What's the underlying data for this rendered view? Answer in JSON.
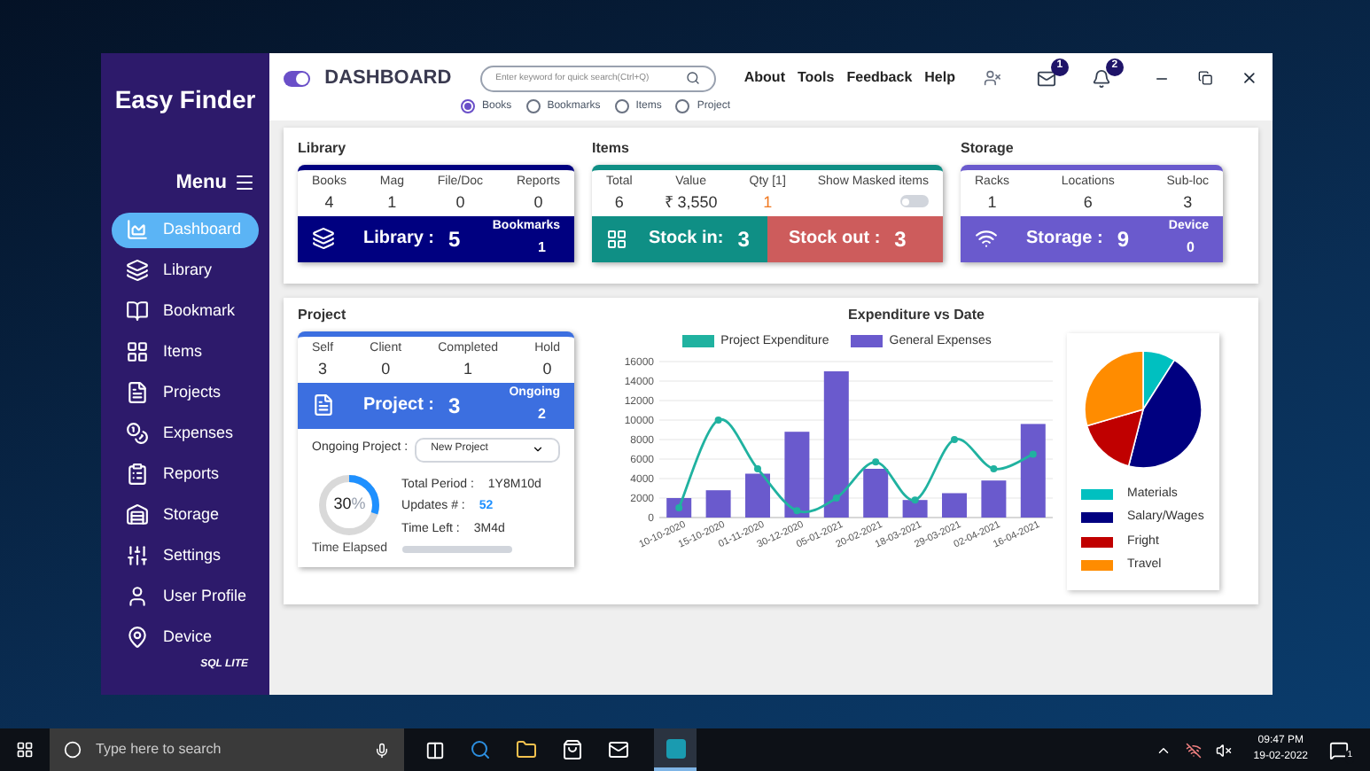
{
  "sidebar": {
    "logo": "Easy Finder",
    "menu_label": "Menu",
    "items": [
      {
        "label": "Dashboard",
        "selected": true
      },
      {
        "label": "Library",
        "selected": false
      },
      {
        "label": "Bookmark",
        "selected": false
      },
      {
        "label": "Items",
        "selected": false
      },
      {
        "label": "Projects",
        "selected": false
      },
      {
        "label": "Expenses",
        "selected": false
      },
      {
        "label": "Reports",
        "selected": false
      },
      {
        "label": "Storage",
        "selected": false
      },
      {
        "label": "Settings",
        "selected": false
      },
      {
        "label": "User Profile",
        "selected": false
      },
      {
        "label": "Device",
        "selected": false
      }
    ],
    "footer": "SQL LITE"
  },
  "header": {
    "toggle": {
      "on": true
    },
    "title": "DASHBOARD",
    "search": {
      "placeholder": "Enter keyword for quick search(Ctrl+Q)"
    },
    "search_scopes": [
      {
        "label": "Books",
        "selected": true
      },
      {
        "label": "Bookmarks",
        "selected": false
      },
      {
        "label": "Items",
        "selected": false
      },
      {
        "label": "Project",
        "selected": false
      }
    ],
    "menu": [
      "About",
      "Tools",
      "Feedback",
      "Help"
    ],
    "mail_badge": "1",
    "bell_badge": "2"
  },
  "library": {
    "title": "Library",
    "stats": [
      {
        "label": "Books",
        "value": "4"
      },
      {
        "label": "Mag",
        "value": "1"
      },
      {
        "label": "File/Doc",
        "value": "0"
      },
      {
        "label": "Reports",
        "value": "0"
      }
    ],
    "summary": {
      "label": "Library :",
      "value": "5",
      "side_label": "Bookmarks",
      "side_value": "1"
    }
  },
  "items": {
    "title": "Items",
    "stats": [
      {
        "label": "Total",
        "value": "6"
      },
      {
        "label": "Value",
        "value": "₹ 3,550"
      },
      {
        "label": "Qty [1]",
        "value": "1"
      }
    ],
    "masked": {
      "label": "Show Masked items",
      "on": false
    },
    "bars": [
      {
        "label": "Stock in:",
        "value": "3",
        "color": "#0f8f85"
      },
      {
        "label": "Stock out :",
        "value": "3",
        "color": "#cd5c5c"
      }
    ]
  },
  "storage": {
    "title": "Storage",
    "stats": [
      {
        "label": "Racks",
        "value": "1"
      },
      {
        "label": "Locations",
        "value": "6"
      },
      {
        "label": "Sub-loc",
        "value": "3"
      }
    ],
    "summary": {
      "label": "Storage :",
      "value": "9",
      "side_label": "Device",
      "side_value": "0"
    }
  },
  "project": {
    "title": "Project",
    "stats": [
      {
        "label": "Self",
        "value": "3"
      },
      {
        "label": "Client",
        "value": "0"
      },
      {
        "label": "Completed",
        "value": "1"
      },
      {
        "label": "Hold",
        "value": "0"
      }
    ],
    "summary": {
      "label": "Project :",
      "value": "3",
      "side_label": "Ongoing",
      "side_value": "2"
    },
    "ongoing_label": "Ongoing Project :",
    "ongoing_select": "New Project",
    "elapsed": {
      "percent": "30",
      "unit": "%",
      "level": 0.3,
      "caption": "Time Elapsed"
    },
    "details": [
      {
        "label": "Total Period :",
        "value": "1Y8M10d",
        "highlight": false
      },
      {
        "label": "Updates # :",
        "value": "52",
        "highlight": true
      },
      {
        "label": "Time Left :",
        "value": "3M4d",
        "highlight": false
      }
    ]
  },
  "expenditure": {
    "chart_data": {
      "type": "bar",
      "title": "Expenditure vs Date",
      "categories": [
        "10-10-2020",
        "15-10-2020",
        "01-11-2020",
        "30-12-2020",
        "05-01-2021",
        "20-02-2021",
        "18-03-2021",
        "29-03-2021",
        "02-04-2021",
        "16-04-2021"
      ],
      "series": [
        {
          "name": "Project Expenditure",
          "color": "#20b2a0",
          "type": "line",
          "marker": true,
          "values": [
            1000,
            10000,
            5000,
            700,
            2000,
            5700,
            1800,
            8000,
            5000,
            6500
          ]
        },
        {
          "name": "General Expenses",
          "color": "#6a5acd",
          "values": [
            2000,
            2800,
            4500,
            8800,
            15000,
            5000,
            1800,
            2500,
            3800,
            9600
          ]
        }
      ],
      "stacked": false,
      "grid": true,
      "legend": true,
      "ylim": [
        0,
        16000
      ],
      "yticks": [
        0,
        2000,
        4000,
        6000,
        8000,
        10000,
        12000,
        14000,
        16000
      ]
    },
    "pie_legend": [
      {
        "label": "Materials",
        "color": "#00c0c0"
      },
      {
        "label": "Salary/Wages",
        "color": "#000080"
      },
      {
        "label": "Fright",
        "color": "#c00000"
      },
      {
        "label": "Travel",
        "color": "#ff8c00"
      }
    ]
  },
  "taskbar": {
    "search": {
      "placeholder": "Type here to search"
    },
    "time": "09:47 PM",
    "date": "19-02-2022",
    "notification_count": "1"
  }
}
